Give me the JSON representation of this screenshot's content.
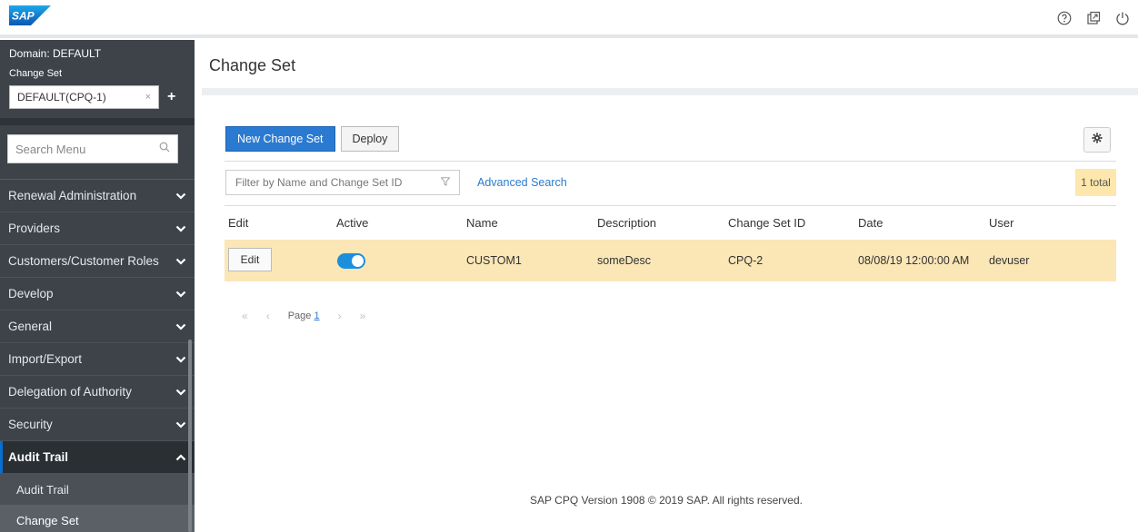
{
  "header": {
    "logo_text": "SAP",
    "icons": [
      "help-icon",
      "open-window-icon",
      "power-icon"
    ]
  },
  "sidebar": {
    "domain_label": "Domain: DEFAULT",
    "change_set_label": "Change Set",
    "change_set_value": "DEFAULT(CPQ-1)",
    "clear_glyph": "×",
    "add_glyph": "+",
    "search_placeholder": "Search Menu",
    "menu": [
      {
        "label": "Renewal Administration"
      },
      {
        "label": "Providers"
      },
      {
        "label": "Customers/Customer Roles"
      },
      {
        "label": "Develop"
      },
      {
        "label": "General"
      },
      {
        "label": "Import/Export"
      },
      {
        "label": "Delegation of Authority"
      },
      {
        "label": "Security"
      },
      {
        "label": "Audit Trail"
      }
    ],
    "submenu": [
      {
        "label": "Audit Trail"
      },
      {
        "label": "Change Set"
      }
    ]
  },
  "main": {
    "page_title": "Change Set",
    "new_button": "New Change Set",
    "deploy_button": "Deploy",
    "filter_placeholder": "Filter by Name and Change Set ID",
    "advanced_search": "Advanced Search",
    "total": "1 total",
    "columns": [
      "Edit",
      "Active",
      "Name",
      "Description",
      "Change Set ID",
      "Date",
      "User"
    ],
    "rows": [
      {
        "edit_label": "Edit",
        "active": true,
        "name": "CUSTOM1",
        "description": "someDesc",
        "change_set_id": "CPQ-2",
        "date": "08/08/19 12:00:00 AM",
        "user": "devuser"
      }
    ],
    "pager": {
      "page_label": "Page",
      "page_number": "1",
      "first": "«",
      "prev": "‹",
      "next": "›",
      "last": "»"
    },
    "footer": "SAP CPQ Version 1908 © 2019 SAP. All rights reserved."
  },
  "colors": {
    "sidebar_bg": "#3d4349",
    "primary": "#2b7ad1",
    "row_highlight": "#fbe6b6",
    "badge": "#fde7ac"
  }
}
